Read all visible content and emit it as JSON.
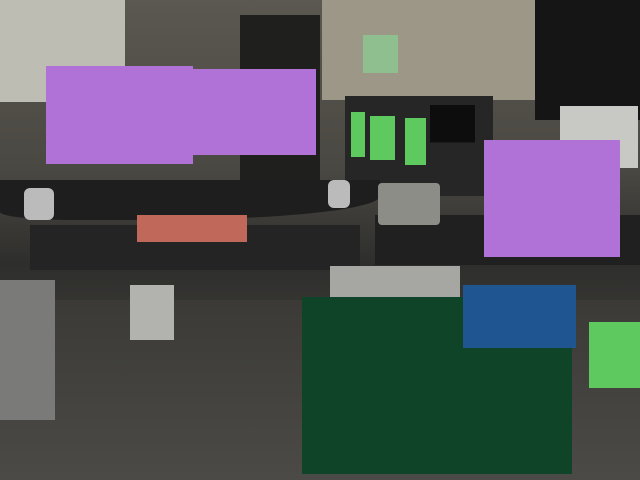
{
  "scene": {
    "description_type": "office-photo-with-masks"
  },
  "colors": {
    "monitor_mask": "#b072d6",
    "small_mask": "#8fbf8f",
    "book_mask": "#5ec95e",
    "keyboard_mask": "#c0695a",
    "chair_mask": "#0f4428",
    "item_mask": "#1f5591",
    "side_mask": "#5ec95e"
  }
}
